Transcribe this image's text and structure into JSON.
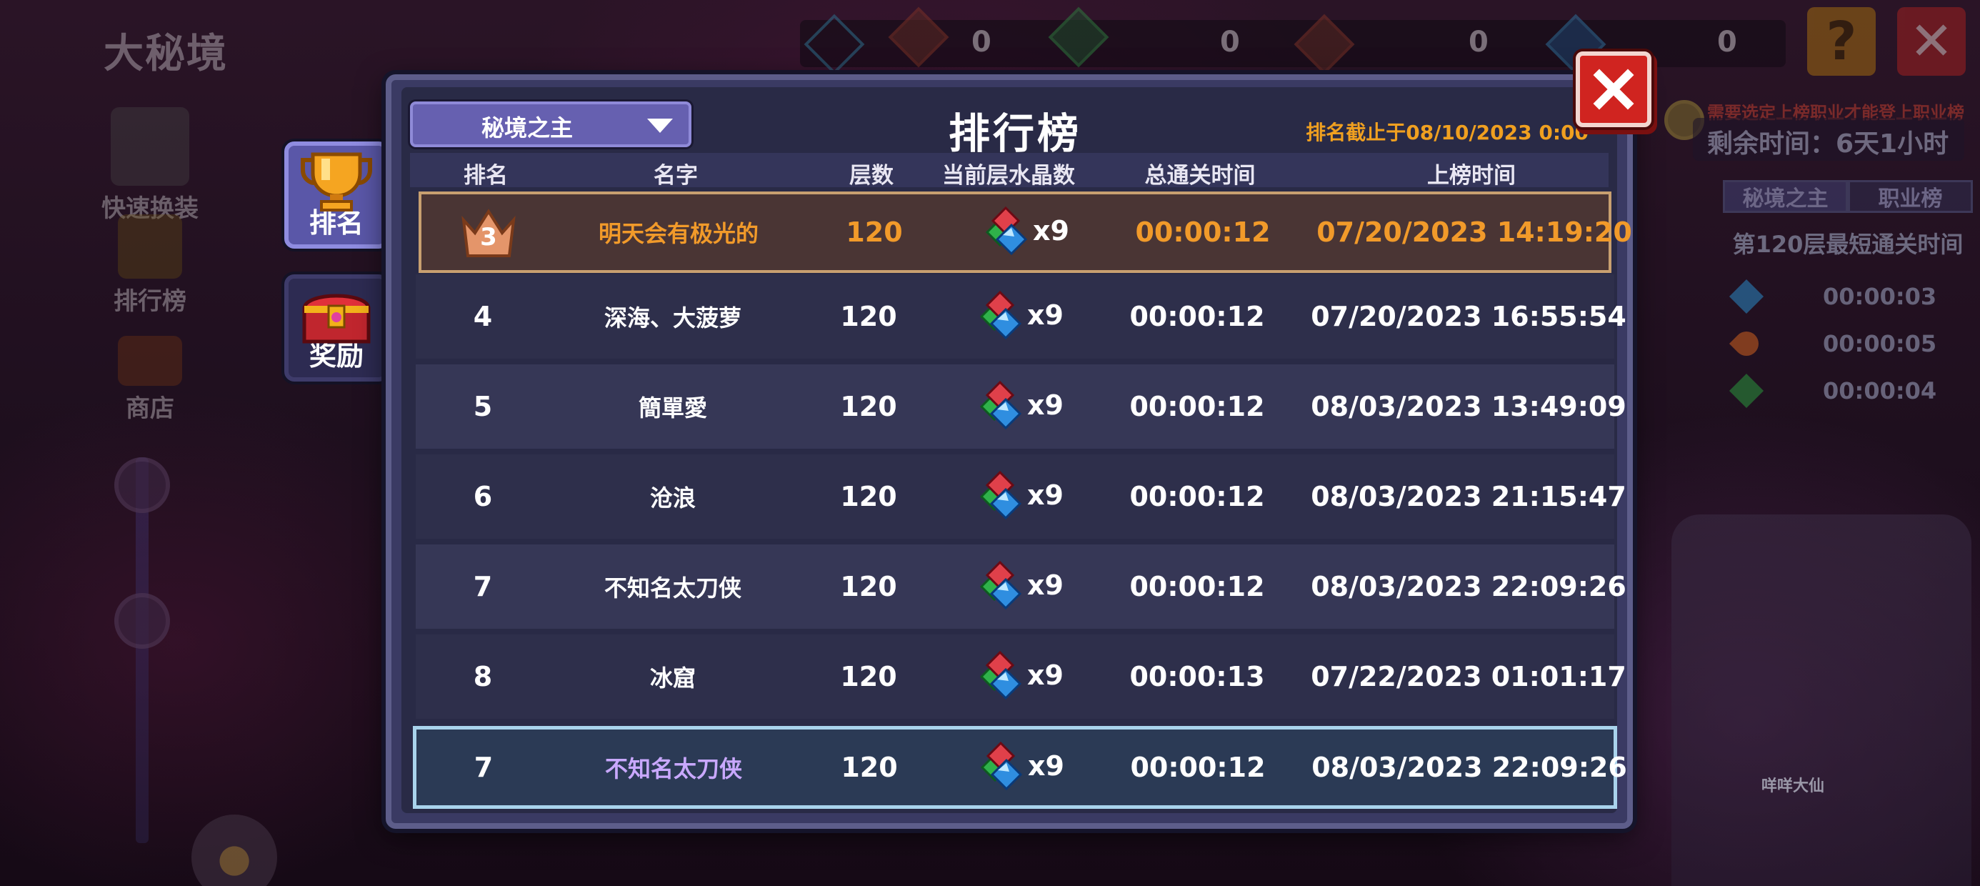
{
  "background": {
    "location_title": "大秘境",
    "top_counters": [
      "0",
      "0",
      "0",
      "0"
    ],
    "left_nav": [
      {
        "label": "快速换装"
      },
      {
        "label": "排行榜"
      },
      {
        "label": "商店"
      }
    ],
    "right_panel": {
      "warning": "需要选定上榜职业才能登上职业榜",
      "timer": "剩余时间：6天1小时",
      "tabs": [
        "秘境之主",
        "职业榜"
      ],
      "subtitle": "第120层最短通关时间",
      "records": [
        {
          "time": "00:00:03",
          "gem_color": "#2a7fb8"
        },
        {
          "time": "00:00:05",
          "gem_color": "#c05a20"
        },
        {
          "time": "00:00:04",
          "gem_color": "#2a8a3a"
        }
      ],
      "npc_label": "咩咩大仙"
    }
  },
  "side_tabs": [
    {
      "label": "排名",
      "icon": "trophy-icon",
      "active": true
    },
    {
      "label": "奖励",
      "icon": "treasure-chest-icon",
      "active": false
    }
  ],
  "leaderboard": {
    "title": "排行榜",
    "dropdown_value": "秘境之主",
    "cutoff": "排名截止于08/10/2023 0:00",
    "columns": [
      "排名",
      "名字",
      "层数",
      "当前层水晶数",
      "总通关时间",
      "上榜时间"
    ],
    "rows": [
      {
        "rank": "3",
        "name": "明天会有极光的",
        "floor": "120",
        "crystals": "x9",
        "total_time": "00:00:12",
        "date": "07/20/2023 14:19:20",
        "style": "top3"
      },
      {
        "rank": "4",
        "name": "深海、大菠萝",
        "floor": "120",
        "crystals": "x9",
        "total_time": "00:00:12",
        "date": "07/20/2023 16:55:54",
        "style": "normal"
      },
      {
        "rank": "5",
        "name": "簡單愛",
        "floor": "120",
        "crystals": "x9",
        "total_time": "00:00:12",
        "date": "08/03/2023 13:49:09",
        "style": "alt"
      },
      {
        "rank": "6",
        "name": "沧浪",
        "floor": "120",
        "crystals": "x9",
        "total_time": "00:00:12",
        "date": "08/03/2023 21:15:47",
        "style": "normal"
      },
      {
        "rank": "7",
        "name": "不知名太刀侠",
        "floor": "120",
        "crystals": "x9",
        "total_time": "00:00:12",
        "date": "08/03/2023 22:09:26",
        "style": "alt"
      },
      {
        "rank": "8",
        "name": "冰窟",
        "floor": "120",
        "crystals": "x9",
        "total_time": "00:00:13",
        "date": "07/22/2023 01:01:17",
        "style": "normal"
      }
    ],
    "self_row": {
      "rank": "7",
      "name": "不知名太刀侠",
      "floor": "120",
      "crystals": "x9",
      "total_time": "00:00:12",
      "date": "08/03/2023 22:09:26"
    }
  },
  "colors": {
    "accent_orange": "#f19a2a",
    "self_name": "#c9a8ff",
    "close_red": "#d02420"
  }
}
